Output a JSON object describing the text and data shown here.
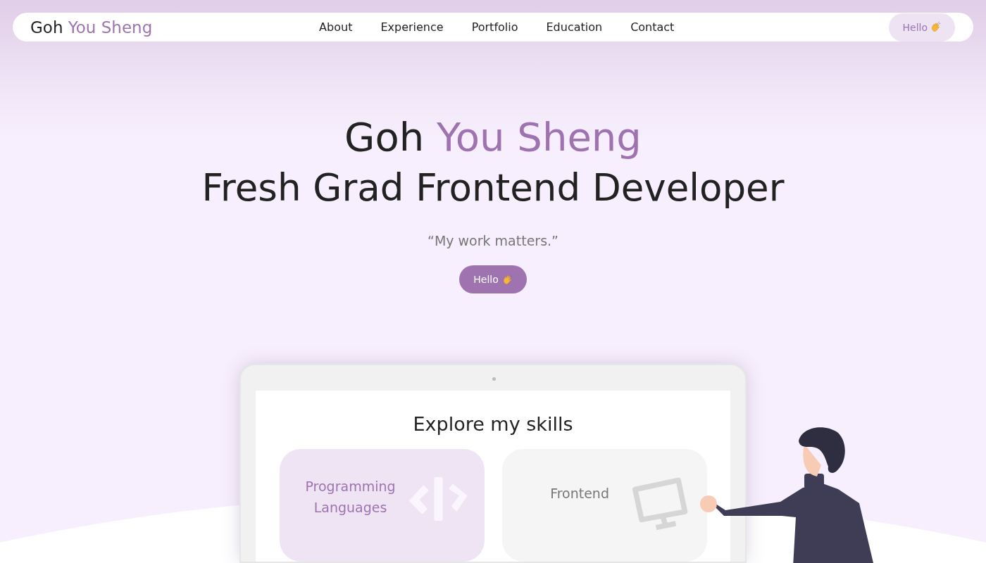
{
  "navbar": {
    "logo": {
      "first": "Goh",
      "rest": "You Sheng"
    },
    "links": [
      {
        "label": "About"
      },
      {
        "label": "Experience"
      },
      {
        "label": "Portfolio"
      },
      {
        "label": "Education"
      },
      {
        "label": "Contact"
      }
    ],
    "button": {
      "label": "Hello"
    }
  },
  "hero": {
    "title_first": "Goh",
    "title_rest": "You Sheng",
    "subtitle": "Fresh Grad Frontend Developer",
    "quote": "“My work matters.”",
    "button": {
      "label": "Hello"
    }
  },
  "skills": {
    "heading": "Explore my skills",
    "cards": [
      {
        "label": "Programming Languages",
        "kind": "code",
        "selected": true
      },
      {
        "label": "Frontend",
        "kind": "monitor",
        "selected": false
      }
    ]
  }
}
